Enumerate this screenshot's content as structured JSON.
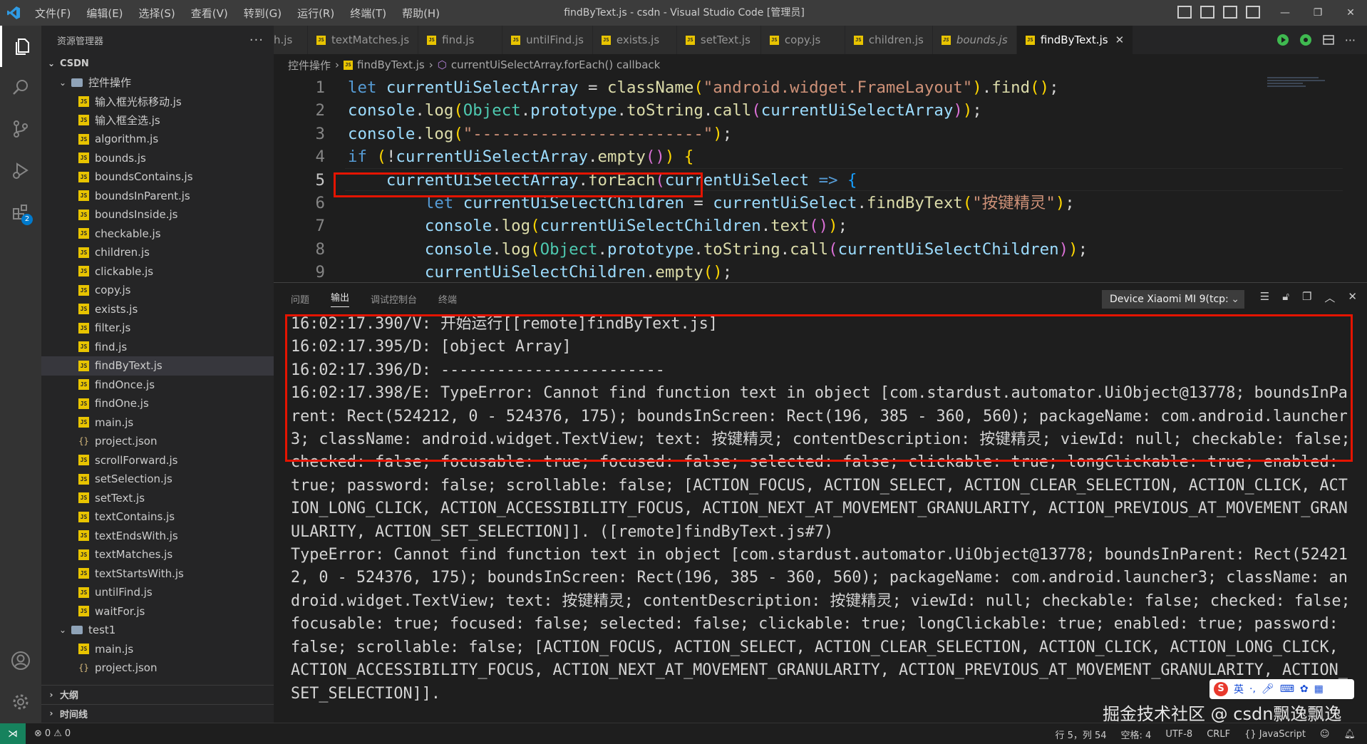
{
  "window": {
    "title": "findByText.js - csdn - Visual Studio Code [管理员]",
    "menu": [
      "文件(F)",
      "编辑(E)",
      "选择(S)",
      "查看(V)",
      "转到(G)",
      "运行(R)",
      "终端(T)",
      "帮助(H)"
    ]
  },
  "activity_bar": {
    "items": [
      "explorer-icon",
      "search-icon",
      "source-control-icon",
      "run-debug-icon",
      "extensions-icon"
    ],
    "extensions_badge": "2",
    "bottom": [
      "account-icon",
      "settings-gear-icon"
    ]
  },
  "sidebar": {
    "title": "资源管理器",
    "more": "···",
    "root": "CSDN",
    "folder1": "控件操作",
    "folder1_files": [
      "输入框光标移动.js",
      "输入框全选.js",
      "algorithm.js",
      "bounds.js",
      "boundsContains.js",
      "boundsInParent.js",
      "boundsInside.js",
      "checkable.js",
      "children.js",
      "clickable.js",
      "copy.js",
      "exists.js",
      "filter.js",
      "find.js",
      "findByText.js",
      "findOnce.js",
      "findOne.js",
      "main.js",
      "project.json",
      "scrollForward.js",
      "setSelection.js",
      "setText.js",
      "textContains.js",
      "textEndsWith.js",
      "textMatches.js",
      "textStartsWith.js",
      "untilFind.js",
      "waitFor.js"
    ],
    "selected_file": "findByText.js",
    "folder2": "test1",
    "folder2_files": [
      "main.js",
      "project.json"
    ],
    "outline_label": "大纲",
    "timeline_label": "时间线"
  },
  "tabs": [
    {
      "label": "h.js",
      "italic": false,
      "active": false
    },
    {
      "label": "textMatches.js",
      "italic": false,
      "active": false
    },
    {
      "label": "find.js",
      "italic": false,
      "active": false
    },
    {
      "label": "untilFind.js",
      "italic": false,
      "active": false
    },
    {
      "label": "exists.js",
      "italic": false,
      "active": false
    },
    {
      "label": "setText.js",
      "italic": false,
      "active": false
    },
    {
      "label": "copy.js",
      "italic": false,
      "active": false
    },
    {
      "label": "children.js",
      "italic": false,
      "active": false
    },
    {
      "label": "bounds.js",
      "italic": true,
      "active": false
    },
    {
      "label": "findByText.js",
      "italic": false,
      "active": true
    }
  ],
  "tab_close": "✕",
  "breadcrumb": {
    "folder": "控件操作",
    "file": "findByText.js",
    "symbol": "currentUiSelectArray.forEach() callback"
  },
  "code": {
    "current_line": 5,
    "lines": [
      {
        "n": "1",
        "tokens": [
          [
            "kw",
            "let "
          ],
          [
            "var",
            "currentUiSelectArray"
          ],
          [
            "pun",
            " = "
          ],
          [
            "fn",
            "className"
          ],
          [
            "br1",
            "("
          ],
          [
            "str",
            "\"android.widget.FrameLayout\""
          ],
          [
            "br1",
            ")"
          ],
          [
            "pun",
            "."
          ],
          [
            "fn",
            "find"
          ],
          [
            "br1",
            "()"
          ],
          [
            "pun",
            ";"
          ]
        ]
      },
      {
        "n": "2",
        "tokens": [
          [
            "var",
            "console"
          ],
          [
            "pun",
            "."
          ],
          [
            "fn",
            "log"
          ],
          [
            "br1",
            "("
          ],
          [
            "cls",
            "Object"
          ],
          [
            "pun",
            "."
          ],
          [
            "var",
            "prototype"
          ],
          [
            "pun",
            "."
          ],
          [
            "fn",
            "toString"
          ],
          [
            "pun",
            "."
          ],
          [
            "fn",
            "call"
          ],
          [
            "br2",
            "("
          ],
          [
            "var",
            "currentUiSelectArray"
          ],
          [
            "br2",
            ")"
          ],
          [
            "br1",
            ")"
          ],
          [
            "pun",
            ";"
          ]
        ]
      },
      {
        "n": "3",
        "tokens": [
          [
            "var",
            "console"
          ],
          [
            "pun",
            "."
          ],
          [
            "fn",
            "log"
          ],
          [
            "br1",
            "("
          ],
          [
            "str",
            "\"------------------------\""
          ],
          [
            "br1",
            ")"
          ],
          [
            "pun",
            ";"
          ]
        ]
      },
      {
        "n": "4",
        "tokens": [
          [
            "kw",
            "if "
          ],
          [
            "br1",
            "("
          ],
          [
            "pun",
            "!"
          ],
          [
            "var",
            "currentUiSelectArray"
          ],
          [
            "pun",
            "."
          ],
          [
            "fn",
            "empty"
          ],
          [
            "br2",
            "()"
          ],
          [
            "br1",
            ")"
          ],
          [
            "pun",
            " "
          ],
          [
            "br1",
            "{"
          ]
        ]
      },
      {
        "n": "5",
        "tokens": [
          [
            "pun",
            "    "
          ],
          [
            "var",
            "currentUiSelectArray"
          ],
          [
            "pun",
            "."
          ],
          [
            "fn",
            "forEach"
          ],
          [
            "br2",
            "("
          ],
          [
            "var",
            "currentUiSelect"
          ],
          [
            "kw",
            " => "
          ],
          [
            "br3",
            "{"
          ]
        ]
      },
      {
        "n": "6",
        "tokens": [
          [
            "pun",
            "        "
          ],
          [
            "kw",
            "let "
          ],
          [
            "var",
            "currentUiSelectChildren"
          ],
          [
            "pun",
            " = "
          ],
          [
            "var",
            "currentUiSelect"
          ],
          [
            "pun",
            "."
          ],
          [
            "fn",
            "findByText"
          ],
          [
            "br1",
            "("
          ],
          [
            "str",
            "\"按键精灵\""
          ],
          [
            "br1",
            ")"
          ],
          [
            "pun",
            ";"
          ]
        ]
      },
      {
        "n": "7",
        "tokens": [
          [
            "pun",
            "        "
          ],
          [
            "var",
            "console"
          ],
          [
            "pun",
            "."
          ],
          [
            "fn",
            "log"
          ],
          [
            "br1",
            "("
          ],
          [
            "var",
            "currentUiSelectChildren"
          ],
          [
            "pun",
            "."
          ],
          [
            "fn",
            "text"
          ],
          [
            "br2",
            "()"
          ],
          [
            "br1",
            ")"
          ],
          [
            "pun",
            ";"
          ]
        ]
      },
      {
        "n": "8",
        "tokens": [
          [
            "pun",
            "        "
          ],
          [
            "var",
            "console"
          ],
          [
            "pun",
            "."
          ],
          [
            "fn",
            "log"
          ],
          [
            "br1",
            "("
          ],
          [
            "cls",
            "Object"
          ],
          [
            "pun",
            "."
          ],
          [
            "var",
            "prototype"
          ],
          [
            "pun",
            "."
          ],
          [
            "fn",
            "toString"
          ],
          [
            "pun",
            "."
          ],
          [
            "fn",
            "call"
          ],
          [
            "br2",
            "("
          ],
          [
            "var",
            "currentUiSelectChildren"
          ],
          [
            "br2",
            ")"
          ],
          [
            "br1",
            ")"
          ],
          [
            "pun",
            ";"
          ]
        ]
      },
      {
        "n": "9",
        "tokens": [
          [
            "pun",
            "        "
          ],
          [
            "var",
            "currentUiSelectChildren"
          ],
          [
            "pun",
            "."
          ],
          [
            "fn",
            "empty"
          ],
          [
            "br1",
            "()"
          ],
          [
            "pun",
            ";"
          ]
        ]
      }
    ]
  },
  "panel": {
    "tabs": [
      "问题",
      "输出",
      "调试控制台",
      "终端"
    ],
    "active_tab": "输出",
    "device": "Device Xiaomi MI 9(tcp:",
    "output_lines": [
      "16:02:17.390/V: 开始运行[[remote]findByText.js]",
      "16:02:17.395/D: [object Array]",
      "16:02:17.396/D: ------------------------",
      "16:02:17.398/E: TypeError: Cannot find function text in object [com.stardust.automator.UiObject@13778; boundsInParent: Rect(524212, 0 - 524376, 175); boundsInScreen: Rect(196, 385 - 360, 560); packageName: com.android.launcher3; className: android.widget.TextView; text: 按键精灵; contentDescription: 按键精灵; viewId: null; checkable: false; checked: false; focusable: true; focused: false; selected: false; clickable: true; longClickable: true; enabled: true; password: false; scrollable: false; [ACTION_FOCUS, ACTION_SELECT, ACTION_CLEAR_SELECTION, ACTION_CLICK, ACTION_LONG_CLICK, ACTION_ACCESSIBILITY_FOCUS, ACTION_NEXT_AT_MOVEMENT_GRANULARITY, ACTION_PREVIOUS_AT_MOVEMENT_GRANULARITY, ACTION_SET_SELECTION]]. ([remote]findByText.js#7)",
      "TypeError: Cannot find function text in object [com.stardust.automator.UiObject@13778; boundsInParent: Rect(524212, 0 - 524376, 175); boundsInScreen: Rect(196, 385 - 360, 560); packageName: com.android.launcher3; className: android.widget.TextView; text: 按键精灵; contentDescription: 按键精灵; viewId: null; checkable: false; checked: false; focusable: true; focused: false; selected: false; clickable: true; longClickable: true; enabled: true; password: false; scrollable: false; [ACTION_FOCUS, ACTION_SELECT, ACTION_CLEAR_SELECTION, ACTION_CLICK, ACTION_LONG_CLICK, ACTION_ACCESSIBILITY_FOCUS, ACTION_NEXT_AT_MOVEMENT_GRANULARITY, ACTION_PREVIOUS_AT_MOVEMENT_GRANULARITY, ACTION_SET_SELECTION]]."
    ]
  },
  "ime": {
    "logo": "S",
    "lang": "英"
  },
  "watermark": "掘金技术社区 @ csdn飘逸飘逸",
  "status": {
    "errors": "0",
    "warnings": "0",
    "position": "行 5，列 54",
    "spaces": "空格: 4",
    "encoding": "UTF-8",
    "eol": "CRLF",
    "language": "JavaScript"
  },
  "colors": {
    "accent": "#007acc",
    "highlight_box": "#e51400",
    "remote": "#16825d"
  }
}
